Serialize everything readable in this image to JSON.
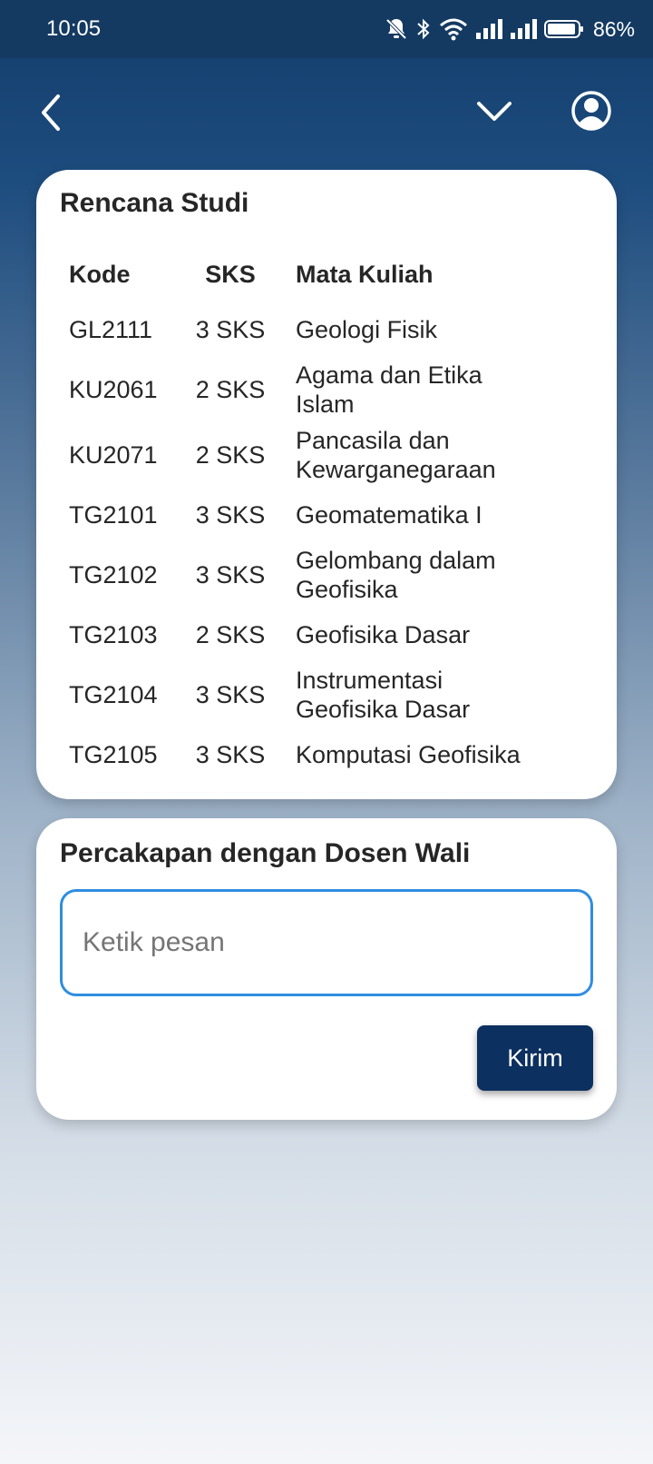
{
  "status_bar": {
    "time": "10:05",
    "battery": "86%",
    "icons": [
      "bell-off-icon",
      "bluetooth-icon",
      "wifi-icon",
      "signal-icon",
      "signal-icon",
      "battery-icon"
    ]
  },
  "header": {
    "icons": [
      "back-arrow-icon",
      "chevron-down-icon",
      "profile-icon"
    ]
  },
  "study_plan": {
    "title": "Rencana Studi",
    "columns": [
      "Kode",
      "SKS",
      "Mata Kuliah"
    ],
    "rows": [
      [
        "GL2111",
        "3 SKS",
        "Geologi Fisik"
      ],
      [
        "KU2061",
        "2 SKS",
        "Agama dan Etika Islam"
      ],
      [
        "KU2071",
        "2 SKS",
        "Pancasila dan Kewarganegaraan"
      ],
      [
        "TG2101",
        "3 SKS",
        "Geomatematika I"
      ],
      [
        "TG2102",
        "3 SKS",
        "Gelombang dalam Geofisika"
      ],
      [
        "TG2103",
        "2 SKS",
        "Geofisika Dasar"
      ],
      [
        "TG2104",
        "3 SKS",
        "Instrumentasi Geofisika Dasar"
      ],
      [
        "TG2105",
        "3 SKS",
        "Komputasi Geofisika"
      ]
    ]
  },
  "chat": {
    "title": "Percakapan dengan Dosen Wali",
    "input_value": "",
    "input_placeholder": "Ketik pesan",
    "send_label": "Kirim"
  },
  "colors": {
    "header_dark": "#143a62",
    "card_bg": "#ffffff",
    "input_border": "#2f8de0",
    "button_bg": "#0c3060"
  }
}
